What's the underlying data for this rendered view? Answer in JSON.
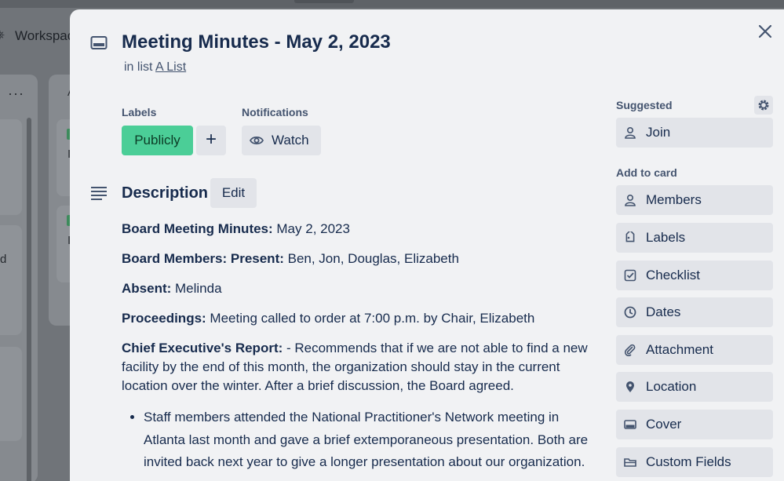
{
  "background": {
    "workspace_label": "Workspac",
    "list_menu": "···",
    "list2_letter": "A",
    "card_letters": [
      "I",
      "d",
      "I"
    ]
  },
  "card": {
    "title": "Meeting Minutes - May 2, 2023",
    "in_list_prefix": "in list",
    "list_name": "A List"
  },
  "labels": {
    "heading": "Labels",
    "items": [
      "Publicly"
    ],
    "add_symbol": "+"
  },
  "notifications": {
    "heading": "Notifications",
    "watch_label": "Watch"
  },
  "description": {
    "heading": "Description",
    "edit_label": "Edit",
    "paragraphs": [
      {
        "label": "Board Meeting Minutes:",
        "text": " May 2, 2023"
      },
      {
        "label": "Board Members: Present:",
        "text": " Ben, Jon, Douglas, Elizabeth"
      },
      {
        "label": "Absent:",
        "text": " Melinda"
      },
      {
        "label": "Proceedings:",
        "text": " Meeting called to order at 7:00 p.m. by Chair, Elizabeth"
      },
      {
        "label": "Chief Executive's Report:",
        "text": " - Recommends that if we are not able to find a new facility by the end of this month, the organization should stay in the current location over the winter. After a brief discussion, the Board agreed."
      }
    ],
    "bullets": [
      "Staff members attended the National Practitioner's Network meeting in Atlanta last month and gave a brief extemporaneous presentation. Both are invited back next year to give a longer presentation about our organization."
    ]
  },
  "sidebar": {
    "suggested_heading": "Suggested",
    "join_label": "Join",
    "add_heading": "Add to card",
    "items": [
      {
        "label": "Members",
        "icon": "person-icon"
      },
      {
        "label": "Labels",
        "icon": "tag-icon"
      },
      {
        "label": "Checklist",
        "icon": "checkbox-icon"
      },
      {
        "label": "Dates",
        "icon": "clock-icon"
      },
      {
        "label": "Attachment",
        "icon": "paperclip-icon"
      },
      {
        "label": "Location",
        "icon": "pin-icon"
      },
      {
        "label": "Cover",
        "icon": "cover-icon"
      },
      {
        "label": "Custom Fields",
        "icon": "fields-icon"
      }
    ]
  },
  "colors": {
    "label_green": "#4bce97",
    "button_bg": "#e2e4e9",
    "modal_bg": "#f1f2f4",
    "text_dark": "#172b4d",
    "text_muted": "#44546f"
  }
}
